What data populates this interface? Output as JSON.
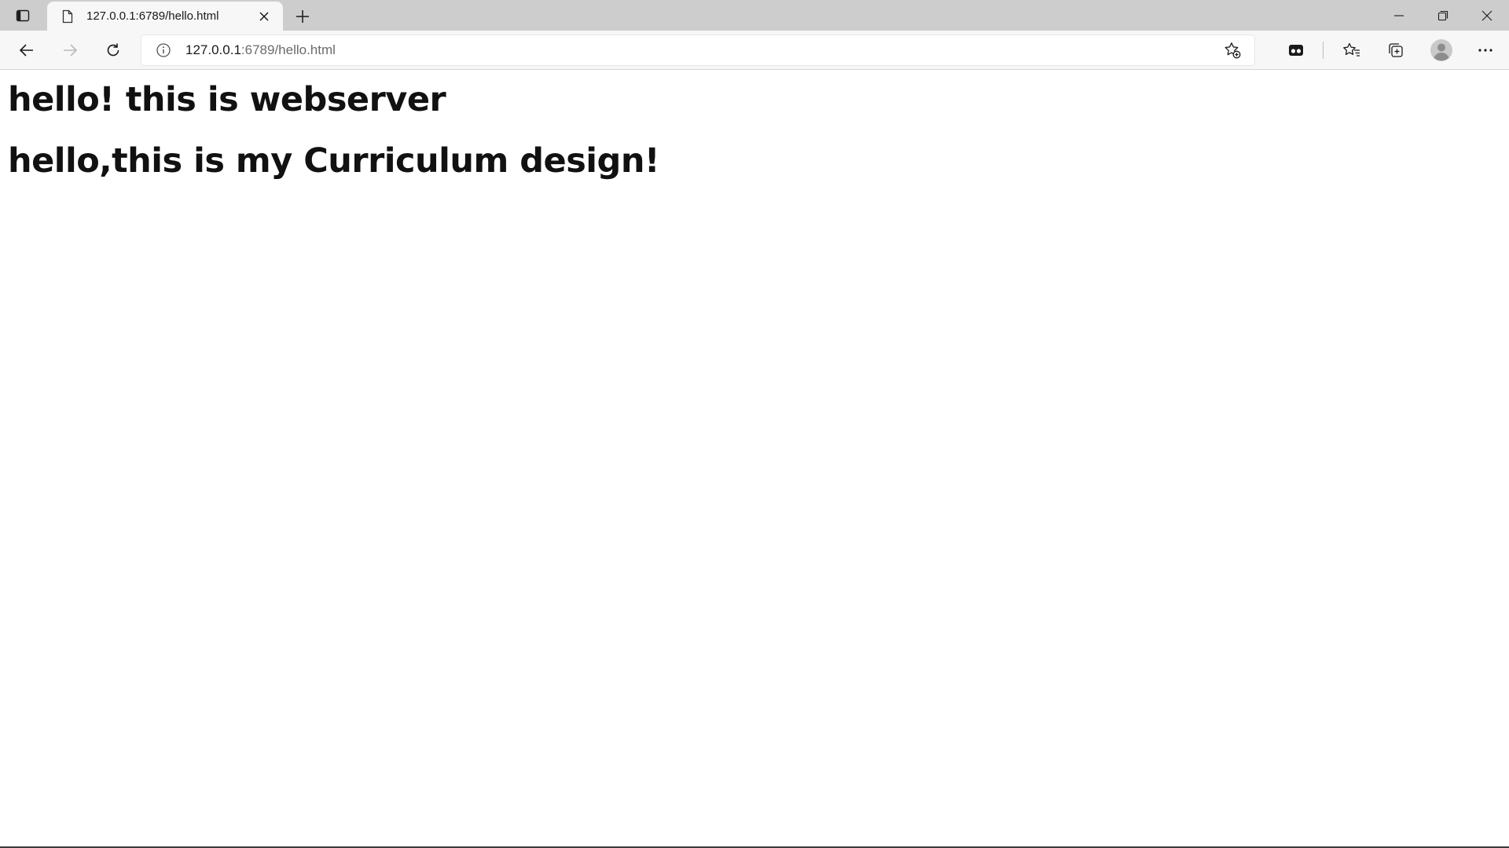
{
  "browser": {
    "tab": {
      "title": "127.0.0.1:6789/hello.html"
    },
    "address_bar": {
      "host": "127.0.0.1",
      "rest": ":6789/hello.html"
    },
    "icons": {
      "tab_actions": "tab-actions-icon",
      "favicon": "page-icon",
      "tab_close": "close-icon",
      "new_tab": "plus-icon",
      "back": "arrow-left-icon",
      "forward": "arrow-right-icon",
      "refresh": "refresh-icon",
      "site_info": "info-icon",
      "add_favorite": "star-plus-icon",
      "extension": "extension-icon",
      "favorites": "favorites-icon",
      "collections": "collections-icon",
      "profile": "avatar-icon",
      "menu": "more-icon"
    }
  },
  "page": {
    "heading_1": "hello! this is webserver",
    "heading_2": "hello,this is my Curriculum design!"
  }
}
